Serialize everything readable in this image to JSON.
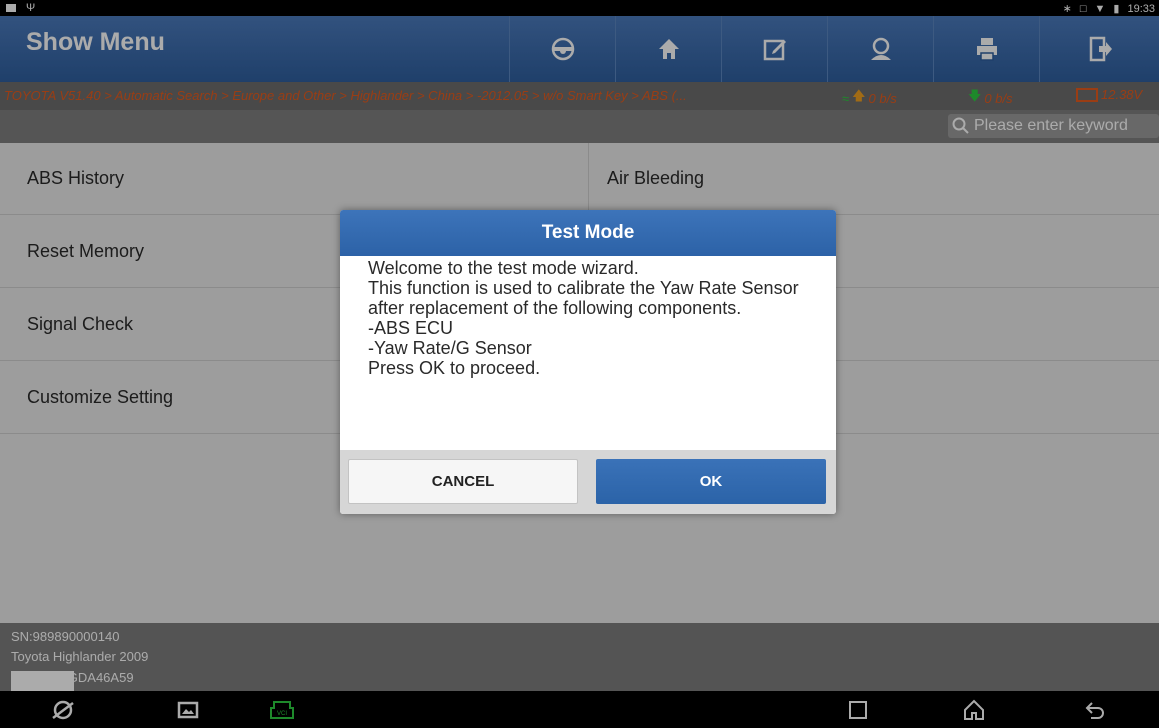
{
  "status_bar": {
    "time": "19:33"
  },
  "header": {
    "title": "Show Menu"
  },
  "breadcrumb": {
    "path": "TOYOTA V51.40 > Automatic Search > Europe and Other > Highlander > China > -2012.05 > w/o Smart Key > ABS (...",
    "upload": "0 b/s",
    "download": "0 b/s",
    "voltage": "12.38V"
  },
  "search": {
    "placeholder": "Please enter keyword"
  },
  "menu": {
    "items": [
      {
        "label": "ABS History"
      },
      {
        "label": "Air Bleeding"
      },
      {
        "label": "Reset Memory"
      },
      {
        "label": "Signal Check"
      },
      {
        "label": "Customize Setting"
      }
    ]
  },
  "footer": {
    "sn": "SN:989890000140",
    "vehicle": "Toyota Highlander 2009",
    "vin": "VIN LVGDA46A59"
  },
  "dialog": {
    "title": "Test Mode",
    "lines": [
      "Welcome to the test mode wizard.",
      "This function is used to calibrate the Yaw Rate Sensor after replacement of the following components.",
      "-ABS ECU",
      "-Yaw Rate/G Sensor",
      "Press OK to proceed."
    ],
    "cancel_label": "CANCEL",
    "ok_label": "OK"
  },
  "colors": {
    "accent": "#2f5f9f",
    "breadcrumb": "#e65c1e",
    "connector": "#2ecc40"
  },
  "icons": {
    "toolbar": [
      "steering-wheel-icon",
      "home-icon",
      "edit-icon",
      "user-icon",
      "print-icon",
      "exit-icon"
    ],
    "nav": [
      "browser-icon",
      "gallery-icon",
      "vci-icon",
      "recents-icon",
      "home-nav-icon",
      "back-icon"
    ]
  }
}
